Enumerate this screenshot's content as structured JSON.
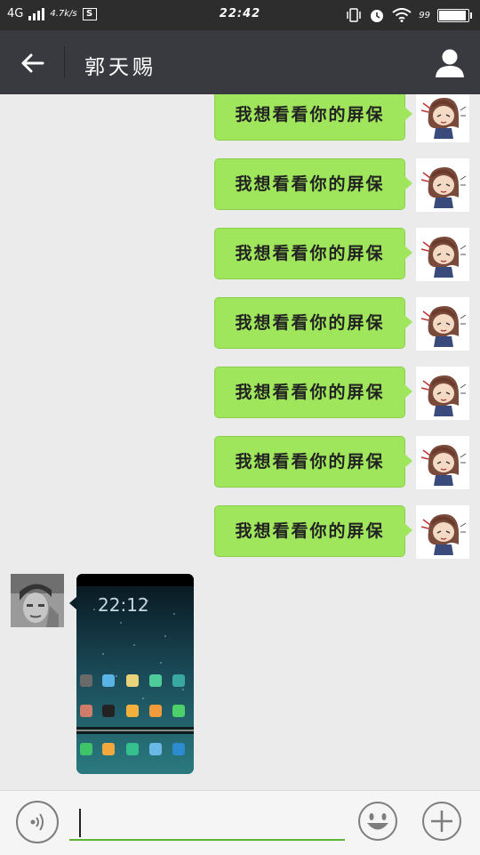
{
  "status_bar": {
    "network": "4G",
    "speed": "4.7k/s",
    "screenshot_badge": "S",
    "time": "22:42",
    "battery": "99"
  },
  "header": {
    "title": "郭天赐"
  },
  "messages": [
    {
      "direction": "out",
      "text": "我想看看你的屏保"
    },
    {
      "direction": "out",
      "text": "我想看看你的屏保"
    },
    {
      "direction": "out",
      "text": "我想看看你的屏保"
    },
    {
      "direction": "out",
      "text": "我想看看你的屏保"
    },
    {
      "direction": "out",
      "text": "我想看看你的屏保"
    },
    {
      "direction": "out",
      "text": "我想看看你的屏保"
    },
    {
      "direction": "out",
      "text": "我想看看你的屏保"
    },
    {
      "direction": "in",
      "type": "image",
      "image_time": "22:12"
    }
  ],
  "colors": {
    "header_bg": "#393a3f",
    "status_bg": "#2d2d2d",
    "bubble_out": "#9fe65c",
    "chat_bg": "#ebebeb",
    "input_underline": "#5fb336"
  },
  "icons": {
    "back": "arrow-left-icon",
    "profile": "person-icon",
    "voice": "voice-icon",
    "emoji": "smiley-icon",
    "more": "plus-icon"
  }
}
